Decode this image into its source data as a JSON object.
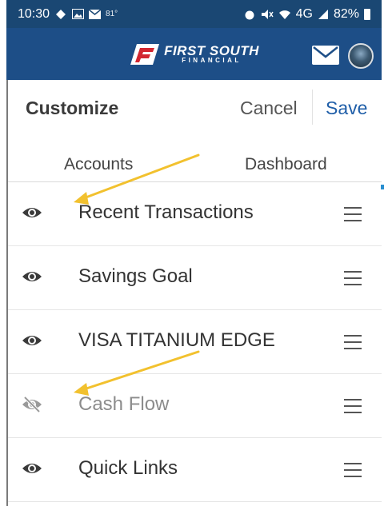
{
  "status_bar": {
    "time": "10:30",
    "temp": "81°",
    "network": "4G",
    "battery": "82%"
  },
  "header": {
    "logo_line1": "FIRST SOUTH",
    "logo_line2": "FINANCIAL"
  },
  "topbar": {
    "title": "Customize",
    "cancel_label": "Cancel",
    "save_label": "Save"
  },
  "tabs": [
    {
      "label": "Accounts"
    },
    {
      "label": "Dashboard"
    }
  ],
  "items": [
    {
      "label": "Recent Transactions",
      "visible": true
    },
    {
      "label": "Savings Goal",
      "visible": true
    },
    {
      "label": "VISA TITANIUM EDGE",
      "visible": true
    },
    {
      "label": "Cash Flow",
      "visible": false
    },
    {
      "label": "Quick Links",
      "visible": true
    }
  ],
  "colors": {
    "header_bg": "#1d4e87",
    "status_bg": "#1a4773",
    "save_link": "#1f5ea8",
    "annotation_arrow": "#f2c12e"
  }
}
